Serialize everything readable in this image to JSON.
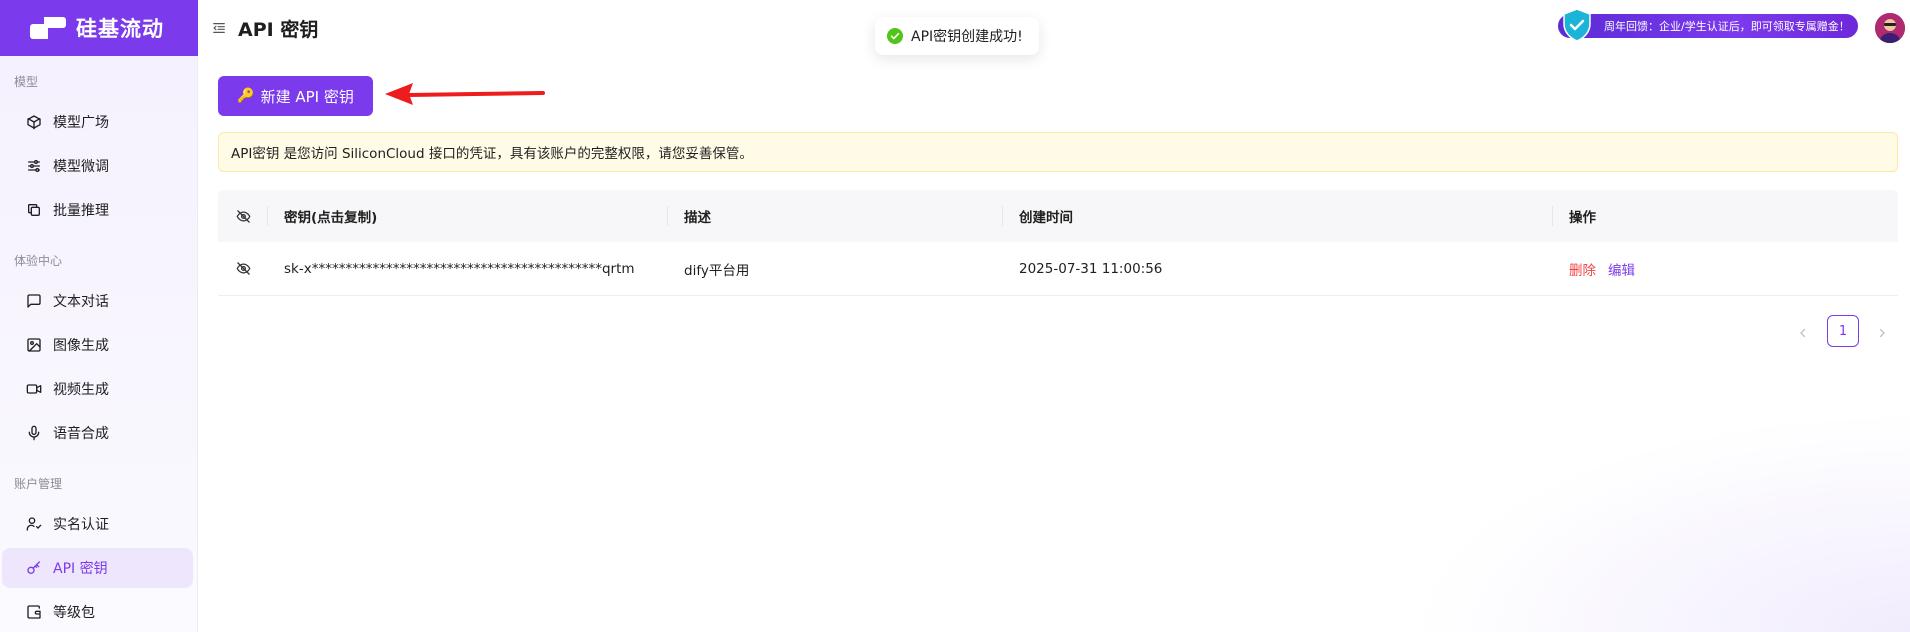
{
  "brand": {
    "name": "硅基流动"
  },
  "sidebar": {
    "groups": [
      {
        "title": "模型"
      },
      {
        "title": "体验中心"
      },
      {
        "title": "账户管理"
      }
    ],
    "items": [
      {
        "label": "模型广场",
        "icon": "cube-icon"
      },
      {
        "label": "模型微调",
        "icon": "sliders-icon"
      },
      {
        "label": "批量推理",
        "icon": "copy-icon"
      },
      {
        "label": "文本对话",
        "icon": "chat-icon"
      },
      {
        "label": "图像生成",
        "icon": "image-icon"
      },
      {
        "label": "视频生成",
        "icon": "video-icon"
      },
      {
        "label": "语音合成",
        "icon": "mic-icon"
      },
      {
        "label": "实名认证",
        "icon": "user-check-icon"
      },
      {
        "label": "API 密钥",
        "icon": "key-icon",
        "active": true
      },
      {
        "label": "等级包",
        "icon": "wallet-icon"
      }
    ]
  },
  "header": {
    "title": "API 密钥",
    "promo": "周年回馈：企业/学生认证后，即可领取专属赠金！"
  },
  "toast": {
    "message": "API密钥创建成功!"
  },
  "main": {
    "create_button": "新建 API 密钥",
    "notice": "API密钥 是您访问 SiliconCloud 接口的凭证，具有该账户的完整权限，请您妥善保管。",
    "table": {
      "columns": [
        "密钥(点击复制)",
        "描述",
        "创建时间",
        "操作"
      ],
      "rows": [
        {
          "key": "sk-x*******************************************qrtm",
          "description": "dify平台用",
          "created": "2025-07-31 11:00:56",
          "actions": {
            "delete": "删除",
            "edit": "编辑"
          }
        }
      ]
    },
    "pagination": {
      "current": "1"
    }
  },
  "colors": {
    "accent": "#7c3aed",
    "danger": "#ef4444",
    "success": "#52c41a",
    "notice_bg": "#fffbe6"
  }
}
